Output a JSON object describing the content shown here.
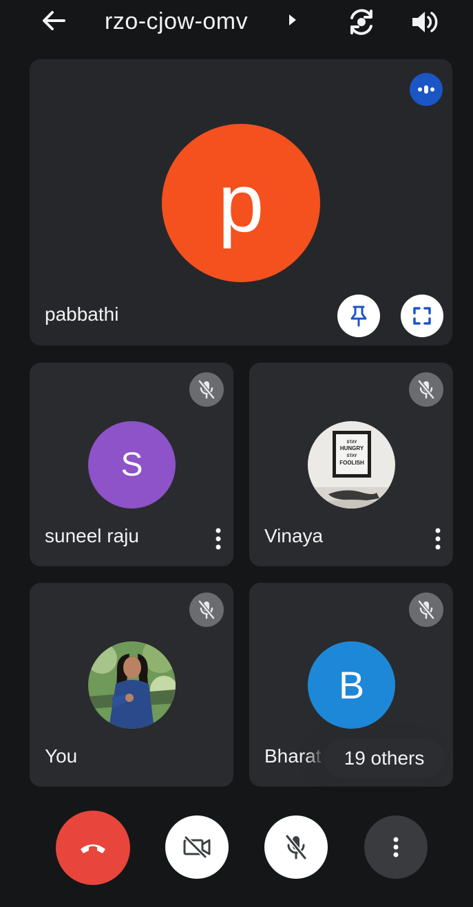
{
  "meeting": {
    "code": "rzo-cjow-omv"
  },
  "icons": {
    "back": "arrow-left-icon",
    "caret": "caret-right-icon",
    "flip_camera": "camera-flip-icon",
    "speaker": "volume-icon",
    "speaking": "audio-level-icon",
    "pin": "pin-icon",
    "fullscreen": "fullscreen-icon",
    "muted": "mic-off-icon",
    "more": "more-vert-icon",
    "end_call": "call-end-icon",
    "camera_off": "videocam-off-icon"
  },
  "main_tile": {
    "name": "pabbathi",
    "initial": "p",
    "avatar_color": "#f4511e"
  },
  "tiles": [
    {
      "name": "suneel raju",
      "initial": "S",
      "avatar_color": "#8e52c9",
      "muted": true
    },
    {
      "name": "Vinaya",
      "avatar_type": "photo",
      "photo_text": [
        "STAY",
        "HUNGRY",
        "STAY",
        "FOOLISH"
      ],
      "muted": true
    },
    {
      "name": "You",
      "avatar_type": "photo",
      "muted": true
    },
    {
      "name": "Bharat",
      "initial": "B",
      "avatar_color": "#1e88d8",
      "muted": true
    }
  ],
  "others_chip": "19 others",
  "colors": {
    "background": "#151618",
    "tile": "#2a2b2e",
    "end_call": "#e8453c",
    "speaking_badge": "#1a56c5"
  }
}
